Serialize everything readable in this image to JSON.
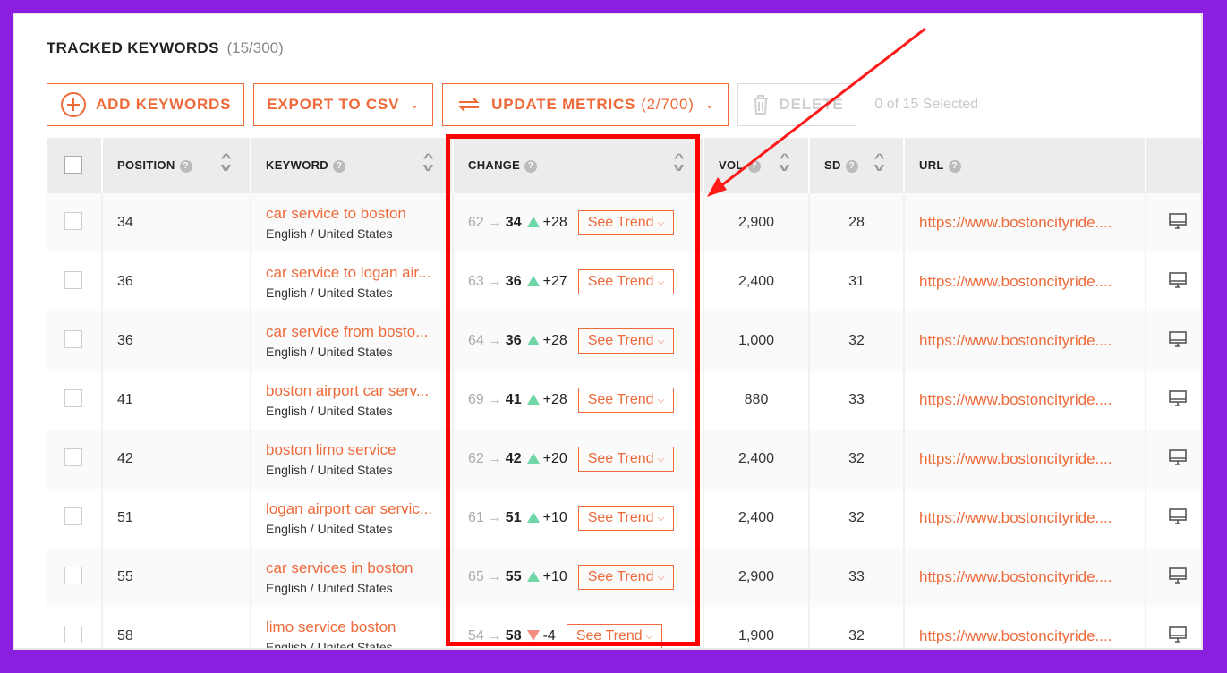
{
  "header": {
    "title": "TRACKED KEYWORDS",
    "count": "(15/300)"
  },
  "toolbar": {
    "add": "ADD KEYWORDS",
    "export": "EXPORT TO CSV",
    "update": "UPDATE METRICS",
    "update_count": "(2/700)",
    "delete": "DELETE",
    "selected": "0 of 15 Selected"
  },
  "columns": {
    "position": "POSITION",
    "keyword": "KEYWORD",
    "change": "CHANGE",
    "vol": "VOL",
    "sd": "SD",
    "url": "URL",
    "help": "?"
  },
  "trend_label": "See Trend",
  "rows": [
    {
      "position": "34",
      "keyword": "car service to boston",
      "location": "English / United States",
      "from": "62",
      "to": "34",
      "direction": "up",
      "delta": "+28",
      "vol": "2,900",
      "sd": "28",
      "url": "https://www.bostoncityride...."
    },
    {
      "position": "36",
      "keyword": "car service to logan air...",
      "location": "English / United States",
      "from": "63",
      "to": "36",
      "direction": "up",
      "delta": "+27",
      "vol": "2,400",
      "sd": "31",
      "url": "https://www.bostoncityride...."
    },
    {
      "position": "36",
      "keyword": "car service from bosto...",
      "location": "English / United States",
      "from": "64",
      "to": "36",
      "direction": "up",
      "delta": "+28",
      "vol": "1,000",
      "sd": "32",
      "url": "https://www.bostoncityride...."
    },
    {
      "position": "41",
      "keyword": "boston airport car serv...",
      "location": "English / United States",
      "from": "69",
      "to": "41",
      "direction": "up",
      "delta": "+28",
      "vol": "880",
      "sd": "33",
      "url": "https://www.bostoncityride...."
    },
    {
      "position": "42",
      "keyword": "boston limo service",
      "location": "English / United States",
      "from": "62",
      "to": "42",
      "direction": "up",
      "delta": "+20",
      "vol": "2,400",
      "sd": "32",
      "url": "https://www.bostoncityride...."
    },
    {
      "position": "51",
      "keyword": "logan airport car servic...",
      "location": "English / United States",
      "from": "61",
      "to": "51",
      "direction": "up",
      "delta": "+10",
      "vol": "2,400",
      "sd": "32",
      "url": "https://www.bostoncityride...."
    },
    {
      "position": "55",
      "keyword": "car services in boston",
      "location": "English / United States",
      "from": "65",
      "to": "55",
      "direction": "up",
      "delta": "+10",
      "vol": "2,900",
      "sd": "33",
      "url": "https://www.bostoncityride...."
    },
    {
      "position": "58",
      "keyword": "limo service boston",
      "location": "English / United States",
      "from": "54",
      "to": "58",
      "direction": "down",
      "delta": "-4",
      "vol": "1,900",
      "sd": "32",
      "url": "https://www.bostoncityride...."
    }
  ],
  "colors": {
    "accent": "#ee6a3a",
    "up": "#6fd6a8",
    "down": "#f28b82",
    "highlight": "#ff0000",
    "frame": "#8a1fe0"
  },
  "icons": {
    "add": "plus-circle-icon",
    "update": "refresh-icon",
    "delete": "trash-icon",
    "row_action": "monitor-icon"
  }
}
